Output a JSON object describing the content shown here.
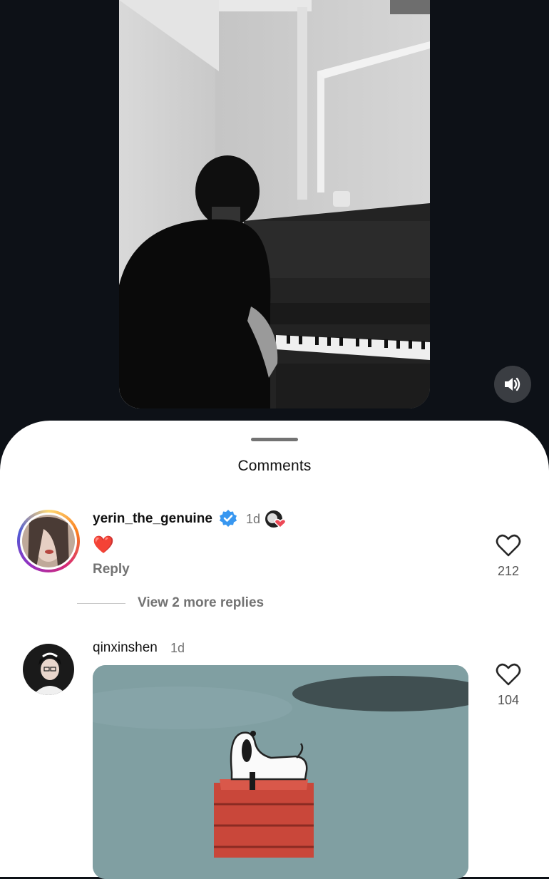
{
  "sheet": {
    "title": "Comments"
  },
  "comments": [
    {
      "username": "yerin_the_genuine",
      "verified": true,
      "time": "1d",
      "text": "❤️",
      "reply_label": "Reply",
      "likes": "212",
      "view_replies": "View 2 more replies"
    },
    {
      "username": "qinxinshen",
      "time": "1d",
      "likes": "104",
      "has_gif": true
    }
  ],
  "icons": {
    "mute": "speaker-icon",
    "like": "heart-outline-icon",
    "verified": "verified-badge-icon"
  },
  "colors": {
    "background": "#0d1117",
    "sheet": "#ffffff",
    "verified": "#3897f0",
    "heart": "#ed4956",
    "muted_text": "#737373"
  }
}
